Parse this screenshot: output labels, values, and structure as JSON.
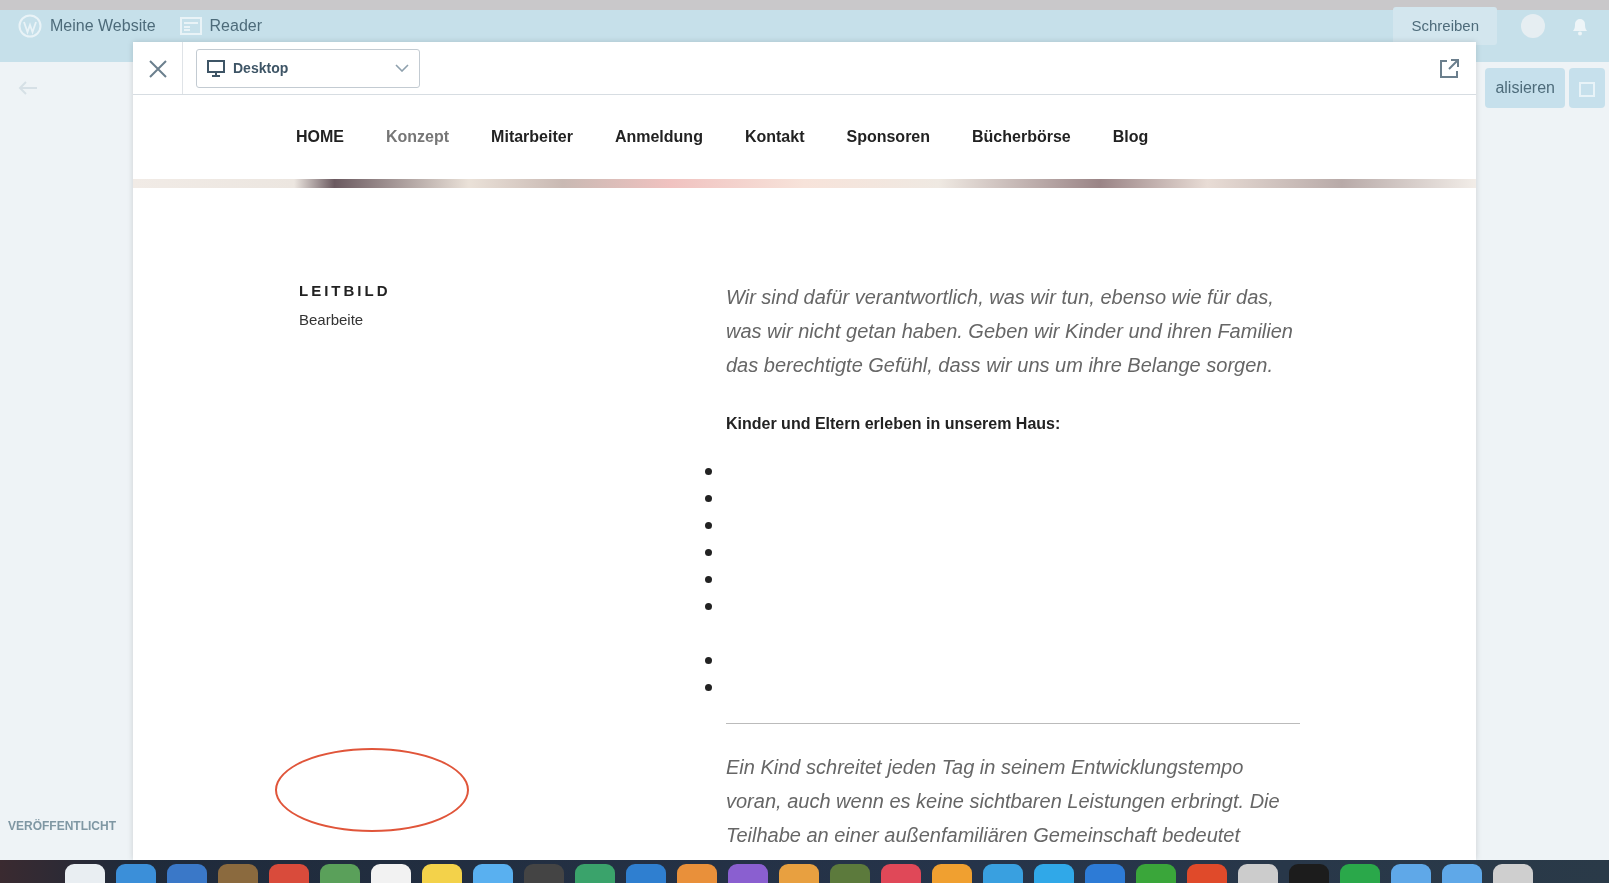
{
  "masterbar": {
    "site": "Meine Website",
    "reader": "Reader",
    "write_button": "Schreiben"
  },
  "editor": {
    "action_button": "alisieren",
    "status": "VERÖFFENTLICHT"
  },
  "preview": {
    "device_select": {
      "value": "Desktop"
    },
    "nav": [
      {
        "label": "HOME",
        "selected": false
      },
      {
        "label": "Konzept",
        "selected": true
      },
      {
        "label": "Mitarbeiter",
        "selected": false
      },
      {
        "label": "Anmeldung",
        "selected": false
      },
      {
        "label": "Kontakt",
        "selected": false
      },
      {
        "label": "Sponsoren",
        "selected": false
      },
      {
        "label": "Bücherbörse",
        "selected": false
      },
      {
        "label": "Blog",
        "selected": false
      }
    ],
    "page": {
      "title": "LEITBILD",
      "edit_link": "Bearbeite",
      "intro": "Wir sind dafür verantwortlich, was wir tun, ebenso wie für das, was wir nicht getan haben. Geben wir Kinder und ihren Familien das berechtigte Gefühl, dass wir uns um ihre Belange sorgen.",
      "subheading": "Kinder und Eltern erleben in unserem Haus:",
      "list": [
        {
          "kind": "bullet"
        },
        {
          "kind": "bullet"
        },
        {
          "kind": "bullet"
        },
        {
          "kind": "bullet"
        },
        {
          "kind": "bullet"
        },
        {
          "kind": "bullet"
        },
        {
          "kind": "gap"
        },
        {
          "kind": "bullet"
        },
        {
          "kind": "bullet"
        }
      ],
      "paragraph": "Ein Kind schreitet jeden Tag in seinem Entwicklungstempo voran, auch wenn es keine sichtbaren Leistungen erbringt. Die Teilhabe an einer außenfamiliären Gemeinschaft bedeutet"
    }
  }
}
